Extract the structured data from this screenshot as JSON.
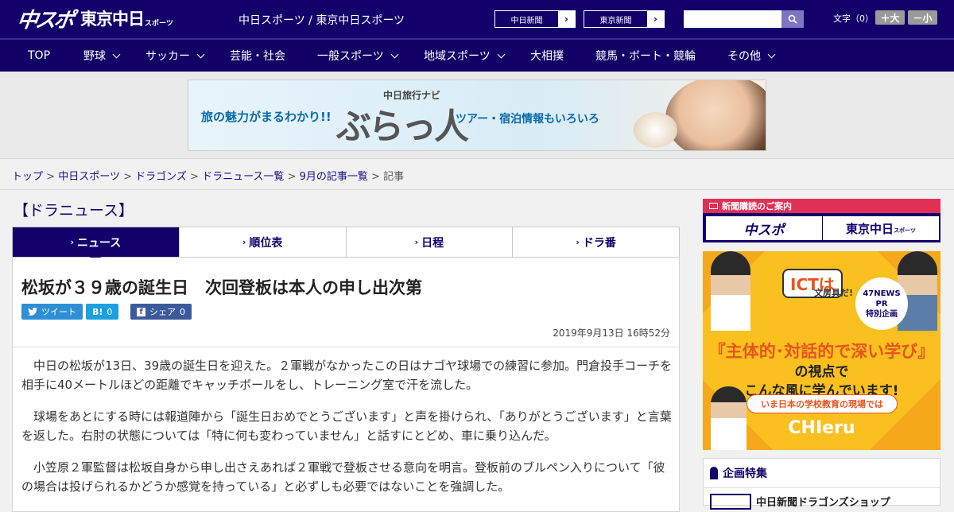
{
  "header": {
    "logo_main": "中スポ",
    "logo_tokyo": "東京中日",
    "logo_sports": "スポーツ",
    "site_name": "中日スポーツ / 東京中日スポーツ",
    "link1": "中日新聞",
    "link2": "東京新聞",
    "font_size_label": "文字（0）",
    "font_up": "＋大",
    "font_down": "－小"
  },
  "nav": {
    "items": [
      {
        "label": "TOP",
        "dropdown": false
      },
      {
        "label": "野球",
        "dropdown": true
      },
      {
        "label": "サッカー",
        "dropdown": true
      },
      {
        "label": "芸能・社会",
        "dropdown": false
      },
      {
        "label": "一般スポーツ",
        "dropdown": true
      },
      {
        "label": "地域スポーツ",
        "dropdown": true
      },
      {
        "label": "大相撲",
        "dropdown": false
      },
      {
        "label": "競馬・ボート・競輪",
        "dropdown": false
      },
      {
        "label": "その他",
        "dropdown": true
      }
    ]
  },
  "banner": {
    "left": "旅の魅力がまるわかり!!",
    "sub": "中日旅行ナビ",
    "logo": "ぶらっ人",
    "right": "ツアー・宿泊情報もいろいろ"
  },
  "breadcrumb": {
    "items": [
      "トップ",
      "中日スポーツ",
      "ドラゴンズ",
      "ドラニュース一覧",
      "9月の記事一覧"
    ],
    "current": "記事",
    "sep": ">"
  },
  "section": {
    "title": "【ドラニュース】"
  },
  "tabs": [
    {
      "label": "ニュース",
      "active": true
    },
    {
      "label": "順位表",
      "active": false
    },
    {
      "label": "日程",
      "active": false
    },
    {
      "label": "ドラ番",
      "active": false
    }
  ],
  "article": {
    "headline": "松坂が３９歳の誕生日　次回登板は本人の申し出次第",
    "share_tweet": "ツイート",
    "share_hatena": "0",
    "share_hatena_icon": "B!",
    "share_fb": "シェア",
    "share_fb_count": "0",
    "date": "2019年9月13日 16時52分",
    "paragraphs": [
      "中日の松坂が13日、39歳の誕生日を迎えた。２軍戦がなかったこの日はナゴヤ球場での練習に参加。門倉投手コーチを相手に40メートルほどの距離でキャッチボールをし、トレーニング室で汗を流した。",
      "球場をあとにする時には報道陣から「誕生日おめでとうございます」と声を掛けられ、「ありがとうございます」と言葉を返した。右肘の状態については「特に何も変わっていません」と話すにとどめ、車に乗り込んだ。",
      "小笠原２軍監督は松坂自身から申し出さえあれば２軍戦で登板させる意向を明言。登板前のブルペン入りについて「彼の場合は投げられるかどうか感覚を持っている」と必ずしも必要ではないことを強調した。"
    ]
  },
  "sidebar": {
    "subscribe_head": "新聞購読のご案内",
    "sub_btn1": "中スポ",
    "sub_btn2": "東京中日",
    "sub_btn2_small": "スポーツ",
    "ict_badge": "ICTは",
    "ict_badge2": "文房具だ!",
    "ict_pr1": "47NEWS",
    "ict_pr2": "PR",
    "ict_pr3": "特別企画",
    "ict_main": "『主体的･対話的で深い学び』",
    "ict_m2a": "の視点で",
    "ict_m2b": "こんな風に学んでいます!",
    "ict_strip": "いま日本の学校教育の現場では",
    "ict_logo": "CHIeru",
    "kikaku_title": "企画特集",
    "kikaku_item": "中日新聞ドラゴンズショップ"
  }
}
